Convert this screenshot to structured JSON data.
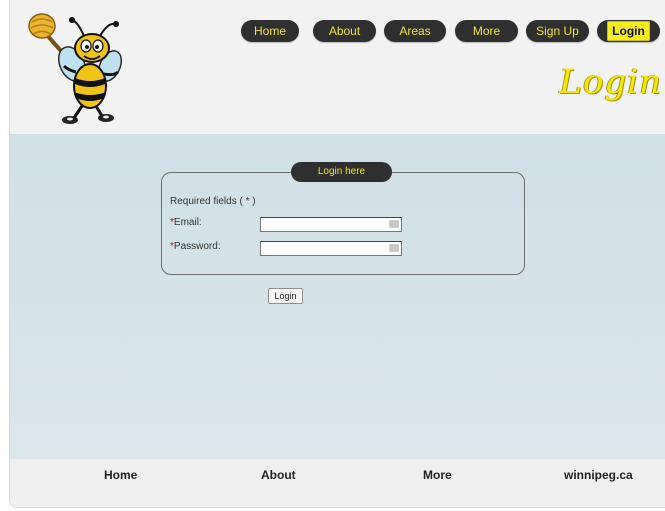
{
  "nav": {
    "items": [
      {
        "label": "Home"
      },
      {
        "label": "About"
      },
      {
        "label": "Areas"
      },
      {
        "label": "More"
      },
      {
        "label": "Sign Up"
      },
      {
        "label": "Login"
      }
    ],
    "active": "Login"
  },
  "header": {
    "page_heading": "Login"
  },
  "login_form": {
    "legend": "Login here",
    "required_note": "Required fields ( * )",
    "email_label": "Email:",
    "password_label": "Password:",
    "required_marker": "*",
    "email_value": "",
    "password_value": "",
    "submit_label": "Login"
  },
  "footer": {
    "links": [
      {
        "label": "Home"
      },
      {
        "label": "About"
      },
      {
        "label": "More"
      },
      {
        "label": "winnipeg.ca"
      }
    ]
  },
  "colors": {
    "accent_yellow": "#f6e50e",
    "button_dark": "#2f2f2f",
    "content_bg": "#d3e1e7"
  },
  "icons": [
    "bee-mascot-icon",
    "key-icon"
  ]
}
